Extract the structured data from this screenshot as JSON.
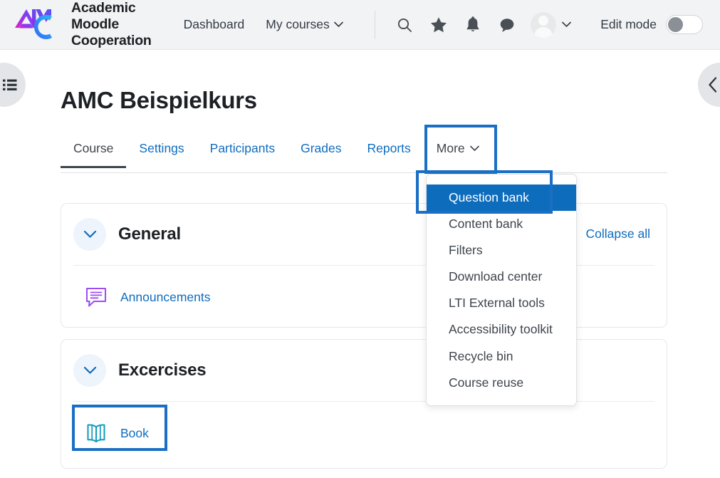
{
  "navbar": {
    "brand": {
      "logo_icon": "amc-monogram-logo",
      "line1": "Academic",
      "line2": "Moodle",
      "line3": "Cooperation"
    },
    "links": [
      {
        "label": "Dashboard",
        "has_chevron": false
      },
      {
        "label": "My courses",
        "has_chevron": true,
        "chevron": "⌄"
      }
    ],
    "icons": [
      {
        "name": "search-icon"
      },
      {
        "name": "star-icon"
      },
      {
        "name": "bell-icon"
      },
      {
        "name": "message-bubble-icon"
      }
    ],
    "user": {
      "avatar_icon": "user-avatar",
      "chevron": "⌄"
    },
    "edit_mode": {
      "label": "Edit mode",
      "state": "off"
    }
  },
  "drawers": {
    "left_toggle_icon": "list-menu-icon",
    "right_toggle_icon": "chevron-left-icon"
  },
  "page": {
    "title": "AMC Beispielkurs"
  },
  "tabs": [
    {
      "label": "Course",
      "active": true,
      "has_chevron": false
    },
    {
      "label": "Settings",
      "active": false,
      "has_chevron": false
    },
    {
      "label": "Participants",
      "active": false,
      "has_chevron": false
    },
    {
      "label": "Grades",
      "active": false,
      "has_chevron": false
    },
    {
      "label": "Reports",
      "active": false,
      "has_chevron": false
    },
    {
      "label": "More",
      "active": false,
      "has_chevron": true,
      "chevron": "⌄"
    }
  ],
  "more_menu": {
    "open": true,
    "items": [
      {
        "label": "Question bank",
        "selected": true
      },
      {
        "label": "Content bank",
        "selected": false
      },
      {
        "label": "Filters",
        "selected": false
      },
      {
        "label": "Download center",
        "selected": false
      },
      {
        "label": "LTI External tools",
        "selected": false
      },
      {
        "label": "Accessibility toolkit",
        "selected": false
      },
      {
        "label": "Recycle bin",
        "selected": false
      },
      {
        "label": "Course reuse",
        "selected": false
      }
    ]
  },
  "course_content": {
    "collapse_all_label": "Collapse all",
    "sections": [
      {
        "name": "General",
        "chevron_icon": "chevron-down-icon",
        "activities": [
          {
            "label": "Announcements",
            "icon": "forum-announcement-icon"
          }
        ]
      },
      {
        "name": "Excercises",
        "chevron_icon": "chevron-down-icon",
        "activities": [
          {
            "label": "Book",
            "icon": "book-icon"
          }
        ]
      }
    ]
  },
  "annotations": {
    "accent_color": "#1a6fc4",
    "boxes": [
      {
        "target": "more-tab"
      },
      {
        "target": "question-bank-menu-item"
      },
      {
        "target": "book-activity"
      }
    ]
  },
  "colors": {
    "navbar_bg": "#f2f3f5",
    "link_blue": "#0f6cbf",
    "menu_selected_bg": "#0e6cbd",
    "text_dark": "#1d2125",
    "annotation_blue": "#1a6fc4"
  }
}
